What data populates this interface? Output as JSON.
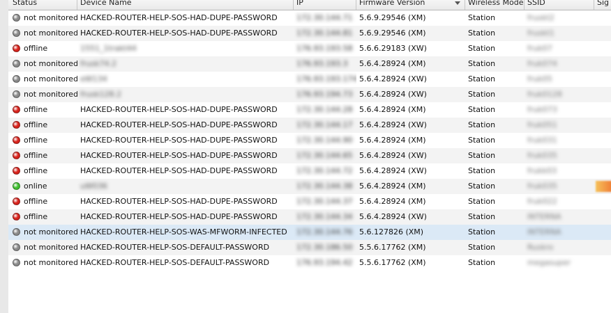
{
  "colors": {
    "online": "#3fbf2f",
    "offline": "#d8231c",
    "not_monitored": "#8a8a8a"
  },
  "columns": {
    "status": "Status",
    "device_name": "Device Name",
    "ip": "IP",
    "firmware": "Firmware Version",
    "wireless_mode": "Wireless Mode",
    "ssid": "SSID",
    "signal": "Sig"
  },
  "rows": [
    {
      "status": "not monitored",
      "state": "not_monitored",
      "name": "HACKED-ROUTER-HELP-SOS-HAD-DUPE-PASSWORD",
      "name_blurred": false,
      "ip": "172.30.144.71",
      "firmware": "5.6.9.29546 (XM)",
      "mode": "Station",
      "ssid": "fruskt2",
      "signal": false
    },
    {
      "status": "not monitored",
      "state": "not_monitored",
      "name": "HACKED-ROUTER-HELP-SOS-HAD-DUPE-PASSWORD",
      "name_blurred": false,
      "ip": "172.30.144.81",
      "firmware": "5.6.9.29546 (XM)",
      "mode": "Station",
      "ssid": "fruskt1",
      "signal": false
    },
    {
      "status": "offline",
      "state": "offline",
      "name": "1551_1trakt44",
      "name_blurred": true,
      "ip": "176.93.193.58",
      "firmware": "5.6.6.29183 (XW)",
      "mode": "Station",
      "ssid": "fruk07",
      "signal": false
    },
    {
      "status": "not monitored",
      "state": "not_monitored",
      "name": "frusk74.2",
      "name_blurred": true,
      "ip": "176.93.193.3",
      "firmware": "5.6.4.28924 (XM)",
      "mode": "Station",
      "ssid": "fruk074",
      "signal": false
    },
    {
      "status": "not monitored",
      "state": "not_monitored",
      "name": "eW134",
      "name_blurred": true,
      "ip": "176.93.193.174",
      "firmware": "5.6.4.28924 (XW)",
      "mode": "Station",
      "ssid": "fruk05",
      "signal": false
    },
    {
      "status": "not monitored",
      "state": "not_monitored",
      "name": "frusk128.2",
      "name_blurred": true,
      "ip": "176.93.194.73",
      "firmware": "5.6.4.28924 (XW)",
      "mode": "Station",
      "ssid": "fruk0128",
      "signal": false
    },
    {
      "status": "offline",
      "state": "offline",
      "name": "HACKED-ROUTER-HELP-SOS-HAD-DUPE-PASSWORD",
      "name_blurred": false,
      "ip": "172.30.144.28",
      "firmware": "5.6.4.28924 (XM)",
      "mode": "Station",
      "ssid": "fruk073",
      "signal": false
    },
    {
      "status": "offline",
      "state": "offline",
      "name": "HACKED-ROUTER-HELP-SOS-HAD-DUPE-PASSWORD",
      "name_blurred": false,
      "ip": "172.30.144.17",
      "firmware": "5.6.4.28924 (XW)",
      "mode": "Station",
      "ssid": "fruk051",
      "signal": false
    },
    {
      "status": "offline",
      "state": "offline",
      "name": "HACKED-ROUTER-HELP-SOS-HAD-DUPE-PASSWORD",
      "name_blurred": false,
      "ip": "172.30.144.90",
      "firmware": "5.6.4.28924 (XM)",
      "mode": "Station",
      "ssid": "fruk031",
      "signal": false
    },
    {
      "status": "offline",
      "state": "offline",
      "name": "HACKED-ROUTER-HELP-SOS-HAD-DUPE-PASSWORD",
      "name_blurred": false,
      "ip": "172.30.144.65",
      "firmware": "5.6.4.28924 (XW)",
      "mode": "Station",
      "ssid": "fruk035",
      "signal": false
    },
    {
      "status": "offline",
      "state": "offline",
      "name": "HACKED-ROUTER-HELP-SOS-HAD-DUPE-PASSWORD",
      "name_blurred": false,
      "ip": "172.30.144.72",
      "firmware": "5.6.4.28924 (XW)",
      "mode": "Station",
      "ssid": "frukk03",
      "signal": false
    },
    {
      "status": "online",
      "state": "online",
      "name": "uW036",
      "name_blurred": true,
      "ip": "172.30.144.38",
      "firmware": "5.6.4.28924 (XM)",
      "mode": "Station",
      "ssid": "fruk035",
      "signal": true
    },
    {
      "status": "offline",
      "state": "offline",
      "name": "HACKED-ROUTER-HELP-SOS-HAD-DUPE-PASSWORD",
      "name_blurred": false,
      "ip": "172.30.144.37",
      "firmware": "5.6.4.28924 (XM)",
      "mode": "Station",
      "ssid": "fruk022",
      "signal": false
    },
    {
      "status": "offline",
      "state": "offline",
      "name": "HACKED-ROUTER-HELP-SOS-HAD-DUPE-PASSWORD",
      "name_blurred": false,
      "ip": "172.30.144.34",
      "firmware": "5.6.4.28924 (XW)",
      "mode": "Station",
      "ssid": "INTERNA",
      "signal": false
    },
    {
      "status": "not monitored",
      "state": "not_monitored",
      "name": "HACKED-ROUTER-HELP-SOS-WAS-MFWORM-INFECTED",
      "name_blurred": false,
      "ip": "172.30.144.76",
      "firmware": "5.6.127826 (XM)",
      "mode": "Station",
      "ssid": "INTERNA",
      "signal": false,
      "selected": true
    },
    {
      "status": "not monitored",
      "state": "not_monitored",
      "name": "HACKED-ROUTER-HELP-SOS-DEFAULT-PASSWORD",
      "name_blurred": false,
      "ip": "172.30.186.50",
      "firmware": "5.5.6.17762 (XM)",
      "mode": "Station",
      "ssid": "Ruskro",
      "signal": false
    },
    {
      "status": "not monitored",
      "state": "not_monitored",
      "name": "HACKED-ROUTER-HELP-SOS-DEFAULT-PASSWORD",
      "name_blurred": false,
      "ip": "176.93.194.42",
      "firmware": "5.5.6.17762 (XM)",
      "mode": "Station",
      "ssid": "megasuper",
      "signal": false
    }
  ]
}
